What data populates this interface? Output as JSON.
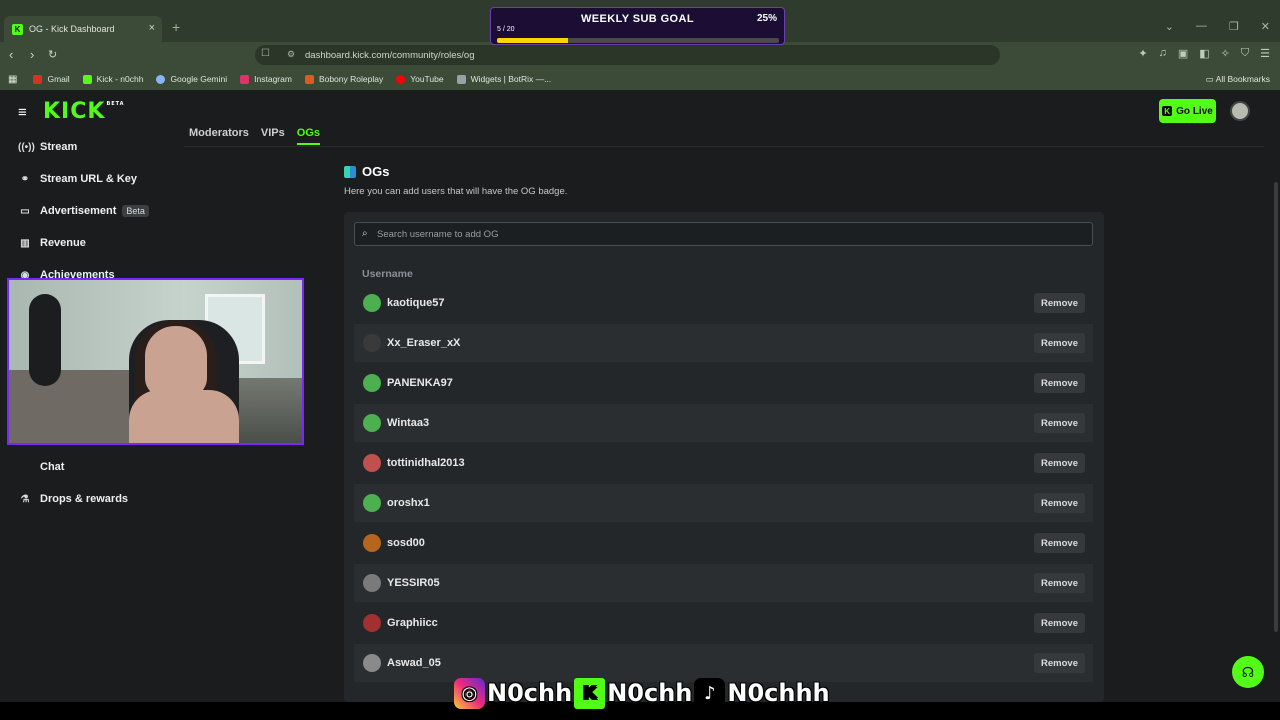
{
  "browser": {
    "tab_title": "OG - Kick Dashboard",
    "tab_close": "×",
    "new_tab": "+",
    "url": "dashboard.kick.com/community/roles/og",
    "bookmarks": [
      {
        "label": "Gmail",
        "color": "#d93025"
      },
      {
        "label": "Kick - n0chh",
        "color": "#53fc18"
      },
      {
        "label": "Google Gemini",
        "color": "#8ab4f8"
      },
      {
        "label": "Instagram",
        "color": "#e1306c"
      },
      {
        "label": "Bobony Roleplay",
        "color": "#e25822"
      },
      {
        "label": "YouTube",
        "color": "#ff0000"
      },
      {
        "label": "Widgets | BotRix —...",
        "color": "#9aa0a6"
      }
    ],
    "all_bookmarks": "All Bookmarks"
  },
  "sub_goal": {
    "title": "WEEKLY SUB GOAL",
    "count": "5 / 20",
    "percent_label": "25%",
    "progress": 0.25,
    "fill_color": "#ffd400"
  },
  "header": {
    "logo": "KICK",
    "logo_tag": "BETA",
    "go_live": "Go Live"
  },
  "sidebar": {
    "items": [
      {
        "label": "Stream",
        "icon": "stream-icon"
      },
      {
        "label": "Stream URL & Key",
        "icon": "link-icon"
      },
      {
        "label": "Advertisement",
        "icon": "ad-icon",
        "badge": "Beta"
      },
      {
        "label": "Revenue",
        "icon": "chart-icon"
      },
      {
        "label": "Achievements",
        "icon": "eye-icon"
      },
      {
        "label": "Chat",
        "icon": ""
      },
      {
        "label": "Drops & rewards",
        "icon": "drops-icon"
      }
    ]
  },
  "roles_tabs": [
    "Moderators",
    "VIPs",
    "OGs"
  ],
  "og": {
    "title": "OGs",
    "description": "Here you can add users that will have the OG badge.",
    "search_placeholder": "Search username to add OG",
    "column_header": "Username",
    "remove_label": "Remove",
    "users": [
      {
        "name": "kaotique57",
        "avatar_color": "#4caf50"
      },
      {
        "name": "Xx_Eraser_xX",
        "avatar_color": "#3a3a3a"
      },
      {
        "name": "PANENKA97",
        "avatar_color": "#4caf50"
      },
      {
        "name": "Wintaa3",
        "avatar_color": "#4caf50"
      },
      {
        "name": "tottinidhal2013",
        "avatar_color": "#c0504d"
      },
      {
        "name": "oroshx1",
        "avatar_color": "#4caf50"
      },
      {
        "name": "sosd00",
        "avatar_color": "#b5651d"
      },
      {
        "name": "YESSIR05",
        "avatar_color": "#7a7a7a"
      },
      {
        "name": "Graphiicc",
        "avatar_color": "#a33030"
      },
      {
        "name": "Aswad_05",
        "avatar_color": "#8a8a8a"
      }
    ]
  },
  "socials": {
    "instagram": "N0chh",
    "kick": "N0chh",
    "tiktok": "N0chhh"
  },
  "colors": {
    "accent": "#53fc18",
    "webcam_border": "#7a26ff"
  }
}
